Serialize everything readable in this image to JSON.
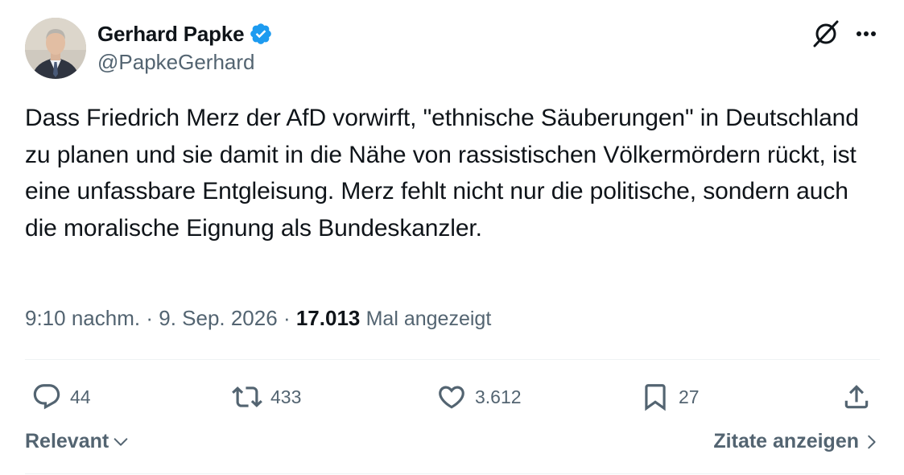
{
  "author": {
    "display_name": "Gerhard Papke",
    "handle": "@PapkeGerhard",
    "verified": true,
    "verified_color": "#1d9bf0"
  },
  "header_icons": [
    "grok-icon",
    "more-icon"
  ],
  "tweet": {
    "text": "Dass Friedrich Merz der AfD vorwirft, \"ethnische Säuberungen\" in Deutschland zu planen und sie damit in die Nähe von rassistischen Völkermördern rückt, ist eine unfassbare Entgleisung. Merz fehlt nicht nur die politische, sondern auch die moralische Eignung als Bundeskanzler."
  },
  "meta": {
    "time": "9:10 nachm.",
    "date": "9. Sep. 2026",
    "separator": "·",
    "views": "17.013",
    "views_label": "Mal angezeigt"
  },
  "actions": {
    "replies": {
      "icon": "reply-icon",
      "count": "44"
    },
    "reposts": {
      "icon": "repost-icon",
      "count": "433"
    },
    "likes": {
      "icon": "like-icon",
      "count": "3.612"
    },
    "bookmarks": {
      "icon": "bookmark-icon",
      "count": "27"
    },
    "share": {
      "icon": "share-icon"
    }
  },
  "footer": {
    "sort_label": "Relevant",
    "quotes_label": "Zitate anzeigen"
  },
  "colors": {
    "text": "#0f1419",
    "secondary": "#536471",
    "divider": "#eff3f4"
  }
}
